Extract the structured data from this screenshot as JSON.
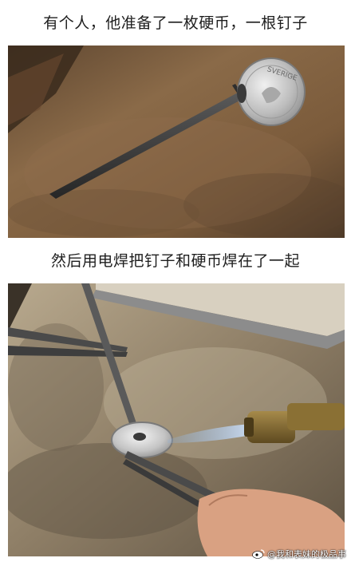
{
  "captions": {
    "first": "有个人，他准备了一枚硬币，一根钉子",
    "second": "然后用电焊把钉子和硬币焊在了一起"
  },
  "coin_text": "SVERIGE",
  "watermark": "@我和表妹的极品事",
  "colors": {
    "wood": "#7a5a3c",
    "metal_bench": "#8a7a64",
    "coin_silver": "#c8c8c8",
    "nail_dark": "#3a3a3a"
  }
}
